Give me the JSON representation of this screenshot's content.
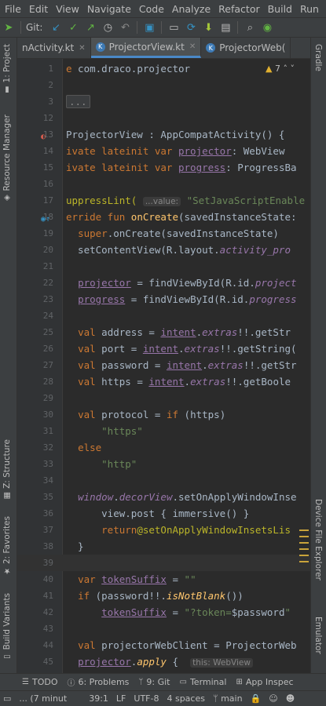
{
  "menu": [
    "File",
    "Edit",
    "View",
    "Navigate",
    "Code",
    "Analyze",
    "Refactor",
    "Build",
    "Run"
  ],
  "toolbar": {
    "git_label": "Git:"
  },
  "left_tabs": {
    "project": "1: Project",
    "resource_manager": "Resource Manager",
    "structure": "Z: Structure",
    "favorites": "2: Favorites",
    "build_variants": "Build Variants"
  },
  "right_tabs": {
    "gradle": "Gradle",
    "device_file_explorer": "Device File Explorer",
    "emulator": "Emulator"
  },
  "tabs": [
    {
      "label": "nActivity.kt",
      "active": false
    },
    {
      "label": "ProjectorView.kt",
      "active": true
    },
    {
      "label": "ProjectorWeb(",
      "active": false
    }
  ],
  "editor": {
    "warning_count": "7",
    "fold_placeholder": "...",
    "hint_value": "...value:",
    "hint_this": "this: WebView"
  },
  "line_numbers": [
    "1",
    "2",
    "3",
    "12",
    "13",
    "14",
    "15",
    "16",
    "17",
    "18",
    "19",
    "20",
    "21",
    "22",
    "23",
    "24",
    "25",
    "26",
    "27",
    "28",
    "29",
    "30",
    "31",
    "32",
    "33",
    "34",
    "35",
    "36",
    "37",
    "38",
    "39",
    "40",
    "41",
    "42",
    "43",
    "44",
    "45"
  ],
  "bottom_bar": [
    "TODO",
    "6: Problems",
    "9: Git",
    "Terminal",
    "App Inspec"
  ],
  "status": {
    "message": "... (7 minut",
    "position": "39:1",
    "line_sep": "LF",
    "encoding": "UTF-8",
    "indent": "4 spaces",
    "branch": "main"
  },
  "colors": {
    "accent": "#4a88c7",
    "keyword": "#cc7832",
    "string": "#6a8759",
    "function": "#ffc66d",
    "annotation": "#bbb529",
    "property": "#9876aa"
  }
}
